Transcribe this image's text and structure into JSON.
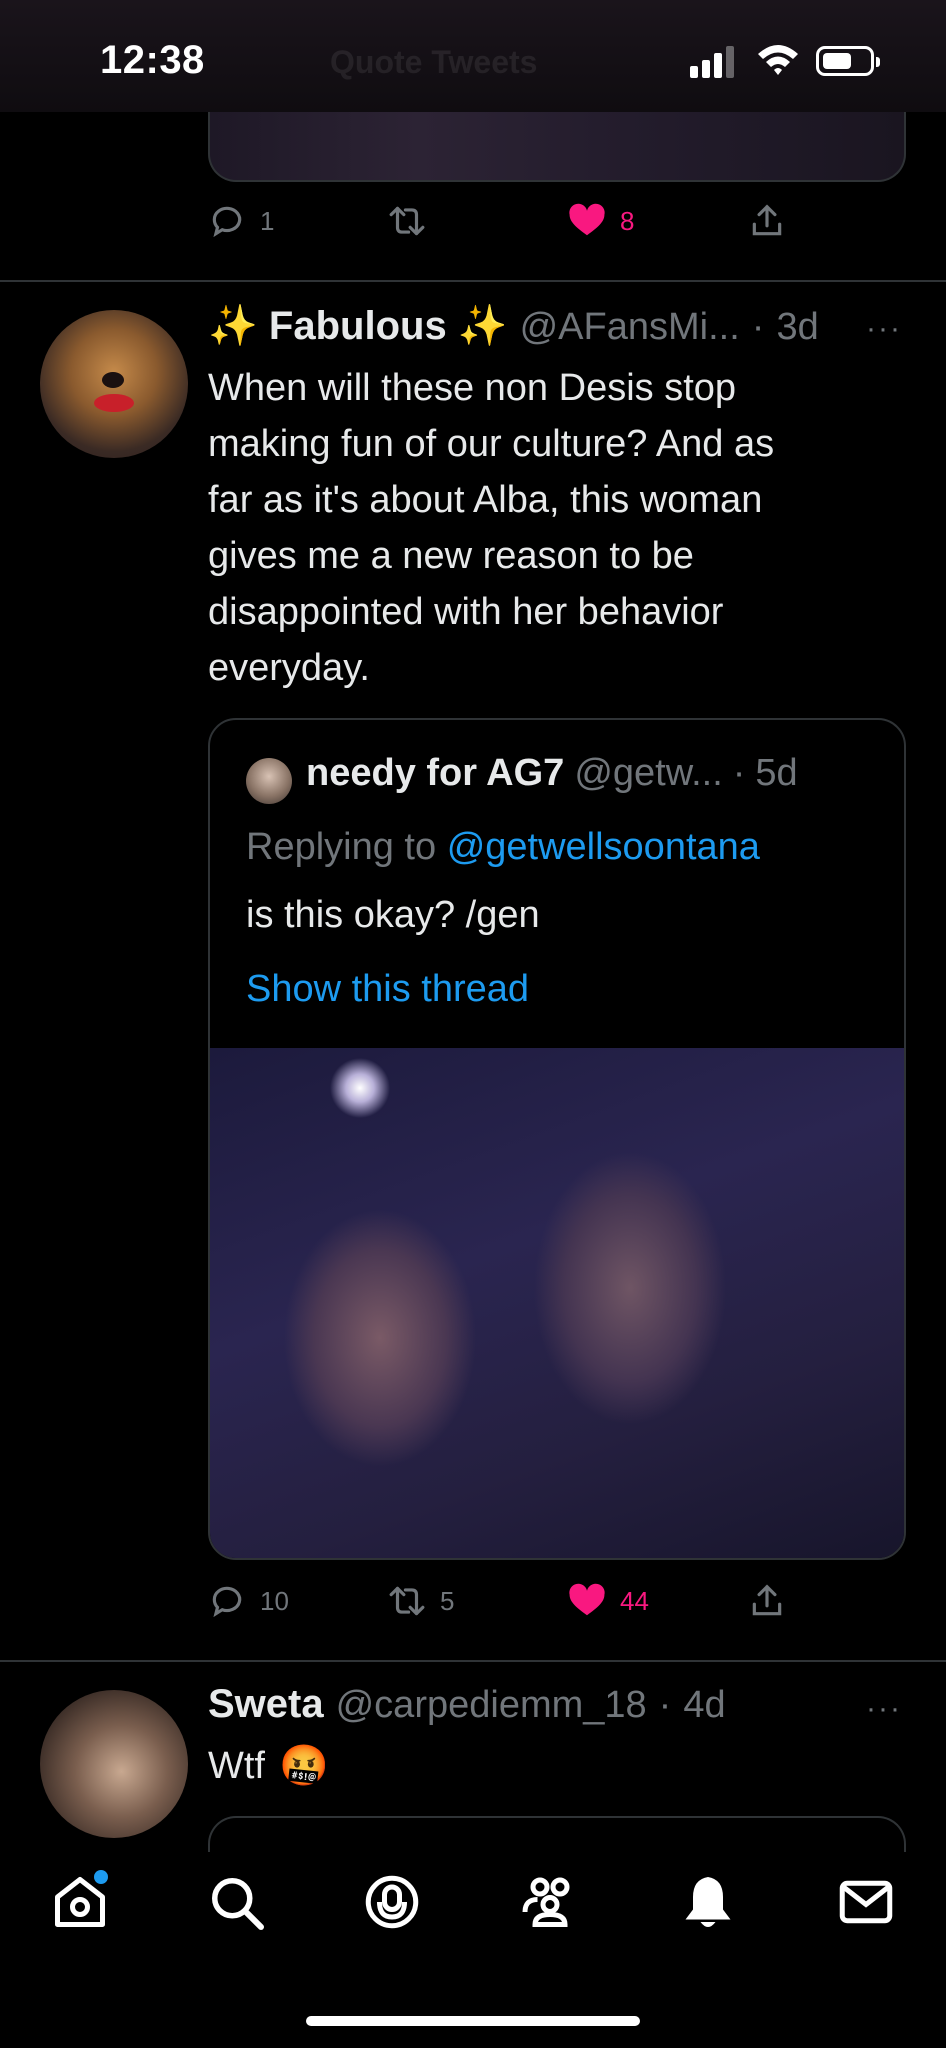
{
  "status_bar": {
    "time": "12:38",
    "ghost_title": "Quote Tweets"
  },
  "prev_tweet": {
    "actions": {
      "replies": "1",
      "retweets": "",
      "likes": "8"
    },
    "colors": {
      "like": "#f91880"
    }
  },
  "tweet": {
    "name": "✨ Fabulous ✨",
    "handle": "@AFansMi...",
    "dot": "·",
    "time": "3d",
    "more": "···",
    "text_lines": [
      "When will these non Desis stop",
      "making fun of our culture? And as",
      "far as it's about Alba, this woman",
      "gives me a new reason to be",
      "disappointed with her behavior",
      "everyday."
    ],
    "quote": {
      "name": "needy for AG7",
      "handle": "@getw...",
      "dot": "·",
      "time": "5d",
      "replying_prefix": "Replying to",
      "replying_handle": "@getwellsoontana",
      "text": "is this okay? /gen",
      "show_thread": "Show this thread"
    },
    "actions": {
      "replies": "10",
      "retweets": "5",
      "likes": "44"
    }
  },
  "next_tweet": {
    "name": "Sweta",
    "handle": "@carpediemm_18",
    "dot": "·",
    "time": "4d",
    "more": "···",
    "text": "Wtf",
    "emoji": "🤬"
  },
  "nav": {
    "items": [
      "home-icon",
      "search-icon",
      "spaces-icon",
      "communities-icon",
      "notifications-icon",
      "messages-icon"
    ]
  },
  "colors": {
    "accent": "#1d9bf0",
    "like": "#f91880",
    "muted": "#71767b",
    "border": "#2f3336"
  }
}
